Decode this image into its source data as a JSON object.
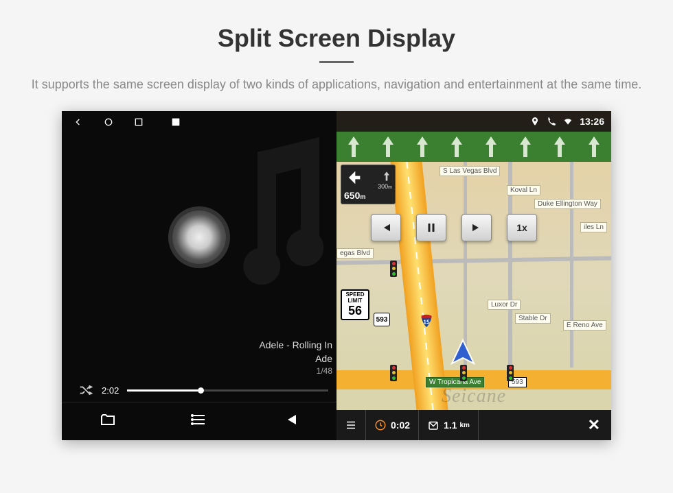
{
  "page": {
    "title": "Split Screen Display",
    "subtitle": "It supports the same screen display of two kinds of applications, navigation and entertainment at the same time."
  },
  "status": {
    "time": "13:26"
  },
  "music": {
    "track_title": "Adele - Rolling In",
    "artist": "Ade",
    "counter": "1/48",
    "elapsed": "2:02"
  },
  "nav": {
    "lanes": 8,
    "turn": {
      "distance": "650",
      "unit": "m",
      "next_distance": "300",
      "next_unit": "m"
    },
    "speed_limit": {
      "label_top": "SPEED",
      "label_mid": "LIMIT",
      "value": "56"
    },
    "route_number": "593",
    "interstate": "15",
    "speed_playback": "1x",
    "roads": {
      "top": "S Las Vegas Blvd",
      "right1": "Koval Ln",
      "right2": "Duke Ellington Way",
      "left1": "egas Blvd",
      "mid1": "Luxor Dr",
      "mid2": "Stable Dr",
      "right3": "E Reno Ave",
      "bottom": "W Tropicana Ave",
      "bottom_num": "593",
      "iles": "iles Ln"
    },
    "bottom": {
      "time": "0:02",
      "distance": "1.1",
      "distance_unit": "km"
    },
    "watermark": "Seicane"
  }
}
